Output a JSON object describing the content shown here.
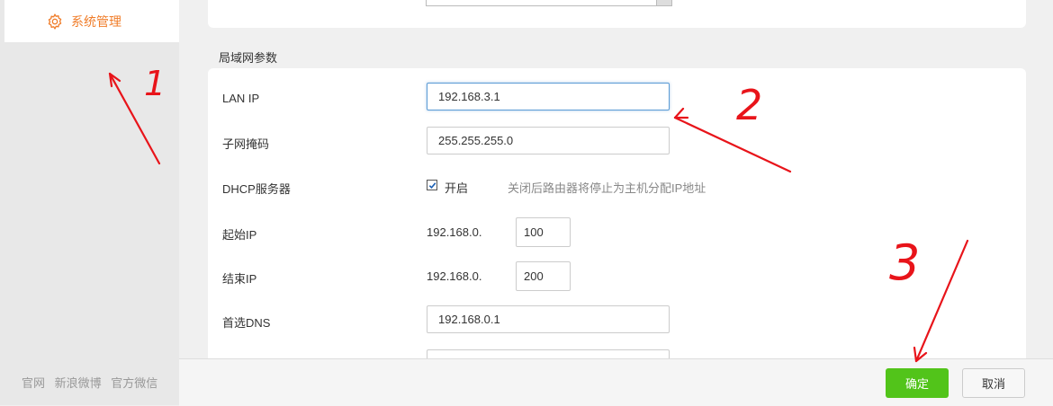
{
  "sidebar": {
    "active_item": "系统管理",
    "footer_links": [
      "官网",
      "新浪微博",
      "官方微信"
    ]
  },
  "section_title": "局域网参数",
  "form": {
    "lan_ip": {
      "label": "LAN IP",
      "value": "192.168.3.1"
    },
    "subnet": {
      "label": "子网掩码",
      "value": "255.255.255.0"
    },
    "dhcp": {
      "label": "DHCP服务器",
      "checkbox_label": "开启",
      "checked": true,
      "hint": "关闭后路由器将停止为主机分配IP地址"
    },
    "start_ip": {
      "label": "起始IP",
      "prefix": "192.168.0.",
      "value": "100"
    },
    "end_ip": {
      "label": "结束IP",
      "prefix": "192.168.0.",
      "value": "200"
    },
    "dns": {
      "label": "首选DNS",
      "value": "192.168.0.1"
    }
  },
  "buttons": {
    "ok": "确定",
    "cancel": "取消"
  },
  "annotations": [
    "1",
    "2",
    "3"
  ],
  "colors": {
    "accent": "#f07d2a",
    "ok_button": "#52c41a",
    "annotation": "#e8141a"
  }
}
